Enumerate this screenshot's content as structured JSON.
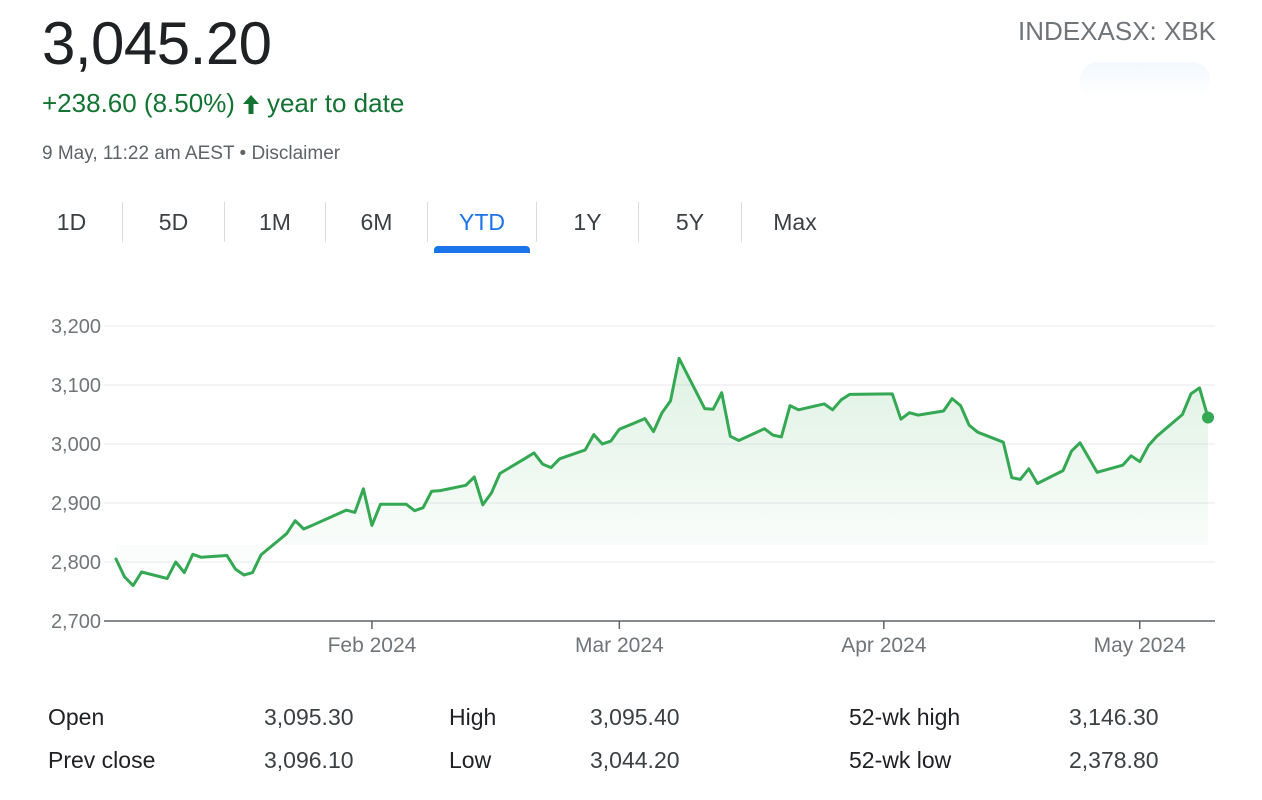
{
  "quote": {
    "price": "3,045.20",
    "ticker": "INDEXASX: XBK",
    "change": "+238.60 (8.50%)",
    "change_period": "year to date",
    "timestamp": "9 May, 11:22 am AEST",
    "separator": "•",
    "disclaimer": "Disclaimer"
  },
  "colors": {
    "up": "#137333",
    "line": "#34a853",
    "accent": "#1a73e8",
    "grid": "#e8eaed",
    "axis_text": "#70757a"
  },
  "tabs": [
    {
      "label": "1D",
      "active": false
    },
    {
      "label": "5D",
      "active": false
    },
    {
      "label": "1M",
      "active": false
    },
    {
      "label": "6M",
      "active": false
    },
    {
      "label": "YTD",
      "active": true
    },
    {
      "label": "1Y",
      "active": false
    },
    {
      "label": "5Y",
      "active": false
    },
    {
      "label": "Max",
      "active": false
    }
  ],
  "chart_data": {
    "type": "area",
    "title": "",
    "xlabel": "",
    "ylabel": "",
    "ylim": [
      2700,
      3200
    ],
    "y_ticks": [
      "3,200",
      "3,100",
      "3,000",
      "2,900",
      "2,800",
      "2,700"
    ],
    "y_tick_values": [
      3200,
      3100,
      3000,
      2900,
      2800,
      2700
    ],
    "x_ticks": [
      {
        "label": "Feb 2024",
        "date": "2024-02-01"
      },
      {
        "label": "Mar 2024",
        "date": "2024-03-01"
      },
      {
        "label": "Apr 2024",
        "date": "2024-04-01"
      },
      {
        "label": "May 2024",
        "date": "2024-05-01"
      }
    ],
    "xlim": [
      "2024-01-02",
      "2024-05-09"
    ],
    "grid": true,
    "series": [
      {
        "x": [
          "2024-01-02",
          "2024-01-03",
          "2024-01-04",
          "2024-01-05",
          "2024-01-08",
          "2024-01-09",
          "2024-01-10",
          "2024-01-11",
          "2024-01-12",
          "2024-01-15",
          "2024-01-16",
          "2024-01-17",
          "2024-01-18",
          "2024-01-19",
          "2024-01-22",
          "2024-01-23",
          "2024-01-24",
          "2024-01-25",
          "2024-01-29",
          "2024-01-30",
          "2024-01-31",
          "2024-02-01",
          "2024-02-02",
          "2024-02-05",
          "2024-02-06",
          "2024-02-07",
          "2024-02-08",
          "2024-02-09",
          "2024-02-12",
          "2024-02-13",
          "2024-02-14",
          "2024-02-15",
          "2024-02-16",
          "2024-02-19",
          "2024-02-20",
          "2024-02-21",
          "2024-02-22",
          "2024-02-23",
          "2024-02-26",
          "2024-02-27",
          "2024-02-28",
          "2024-02-29",
          "2024-03-01",
          "2024-03-04",
          "2024-03-05",
          "2024-03-06",
          "2024-03-07",
          "2024-03-08",
          "2024-03-11",
          "2024-03-12",
          "2024-03-13",
          "2024-03-14",
          "2024-03-15",
          "2024-03-18",
          "2024-03-19",
          "2024-03-20",
          "2024-03-21",
          "2024-03-22",
          "2024-03-25",
          "2024-03-26",
          "2024-03-27",
          "2024-03-28",
          "2024-04-02",
          "2024-04-03",
          "2024-04-04",
          "2024-04-05",
          "2024-04-08",
          "2024-04-09",
          "2024-04-10",
          "2024-04-11",
          "2024-04-12",
          "2024-04-15",
          "2024-04-16",
          "2024-04-17",
          "2024-04-18",
          "2024-04-19",
          "2024-04-22",
          "2024-04-23",
          "2024-04-24",
          "2024-04-26",
          "2024-04-29",
          "2024-04-30",
          "2024-05-01",
          "2024-05-02",
          "2024-05-03",
          "2024-05-06",
          "2024-05-07",
          "2024-05-08",
          "2024-05-09"
        ],
        "y": [
          2805,
          2775,
          2760,
          2783,
          2772,
          2800,
          2782,
          2813,
          2808,
          2811,
          2788,
          2778,
          2782,
          2812,
          2848,
          2870,
          2856,
          2862,
          2888,
          2884,
          2924,
          2862,
          2898,
          2898,
          2887,
          2892,
          2920,
          2921,
          2930,
          2944,
          2897,
          2917,
          2950,
          2976,
          2985,
          2966,
          2960,
          2975,
          2990,
          3016,
          3000,
          3005,
          3025,
          3043,
          3021,
          3053,
          3073,
          3145,
          3060,
          3059,
          3087,
          3013,
          3006,
          3026,
          3015,
          3012,
          3065,
          3058,
          3068,
          3058,
          3075,
          3084,
          3085,
          3042,
          3053,
          3049,
          3056,
          3077,
          3065,
          3032,
          3020,
          3003,
          2943,
          2940,
          2958,
          2933,
          2955,
          2988,
          3002,
          2952,
          2964,
          2980,
          2970,
          2997,
          3013,
          3050,
          3085,
          3095,
          3045
        ]
      }
    ],
    "last_point": {
      "date": "2024-05-09",
      "value": 3045
    }
  },
  "stats": {
    "open_label": "Open",
    "open": "3,095.30",
    "prev_close_label": "Prev close",
    "prev_close": "3,096.10",
    "high_label": "High",
    "high": "3,095.40",
    "low_label": "Low",
    "low": "3,044.20",
    "wk52_high_label": "52-wk high",
    "wk52_high": "3,146.30",
    "wk52_low_label": "52-wk low",
    "wk52_low": "2,378.80"
  }
}
